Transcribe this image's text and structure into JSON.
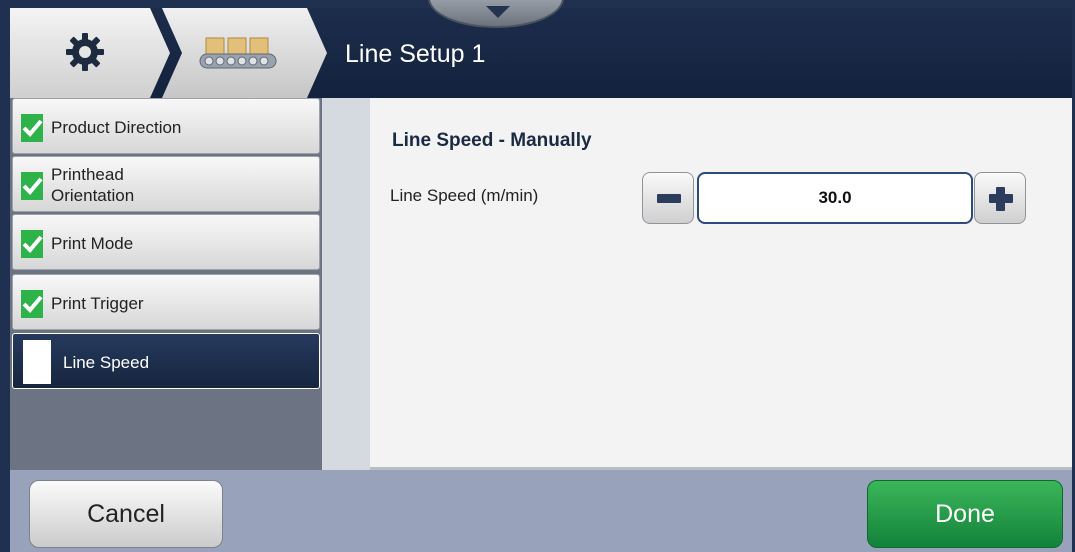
{
  "header": {
    "title": "Line Setup 1",
    "breadcrumb": [
      {
        "icon": "gear-icon"
      },
      {
        "icon": "conveyor-icon"
      }
    ]
  },
  "nav": {
    "items": [
      {
        "label": "Product Direction",
        "status": "complete"
      },
      {
        "label": "Printhead\nOrientation",
        "status": "complete"
      },
      {
        "label": "Print Mode",
        "status": "complete"
      },
      {
        "label": "Print Trigger",
        "status": "complete"
      },
      {
        "label": "Line Speed",
        "status": "active"
      }
    ]
  },
  "main": {
    "section_title": "Line Speed - Manually",
    "field_label": "Line Speed (m/min)",
    "line_speed_value": "30.0"
  },
  "footer": {
    "cancel_label": "Cancel",
    "done_label": "Done"
  },
  "colors": {
    "header_bg": "#1c2d4c",
    "done_green": "#1f9b45",
    "check_green": "#2db34a",
    "footer_bg": "#98a3bb"
  }
}
